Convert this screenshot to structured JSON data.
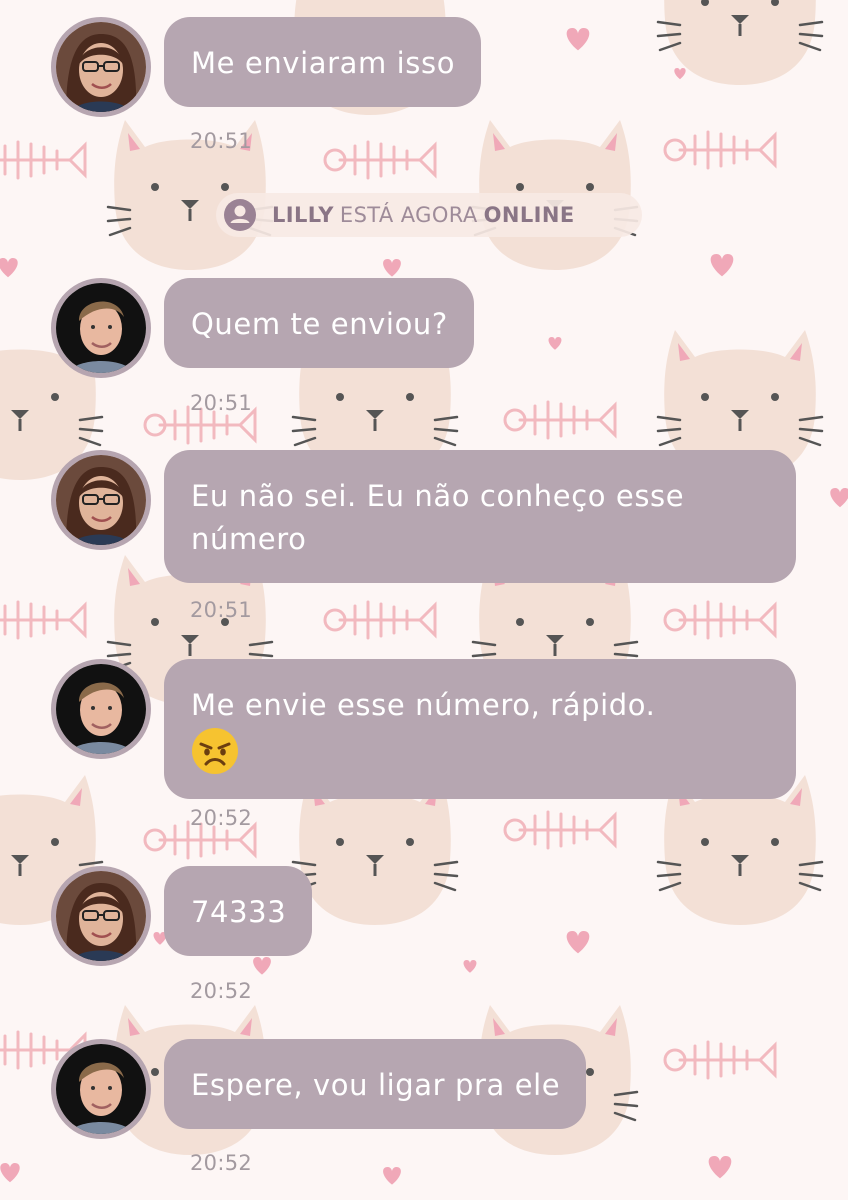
{
  "colors": {
    "background": "#fdf6f5",
    "bubble": "#b6a6b1",
    "avatar_ring": "#b6a5b0",
    "timestamp": "#a39aa0",
    "status_text": "#9e8b99",
    "cat": "#f3e0d6",
    "heart": "#f0a8b8"
  },
  "status": {
    "icon": "user-icon",
    "name": "LILLY",
    "text": "ESTÁ AGORA",
    "state": "ONLINE"
  },
  "messages": [
    {
      "sender": "woman",
      "text": "Me enviaram isso",
      "time": "20:51"
    },
    {
      "sender": "man",
      "text": "Quem te enviou?",
      "time": "20:51"
    },
    {
      "sender": "woman",
      "line1": "Eu não sei. Eu não conheço esse",
      "line2": "número",
      "time": "20:51"
    },
    {
      "sender": "man",
      "text": "Me envie esse número, rápido.",
      "emoji": "angry-face-emoji",
      "time": "20:52"
    },
    {
      "sender": "woman",
      "text": "74333",
      "time": "20:52"
    },
    {
      "sender": "man",
      "text": "Espere, vou ligar pra ele",
      "time": "20:52"
    }
  ]
}
